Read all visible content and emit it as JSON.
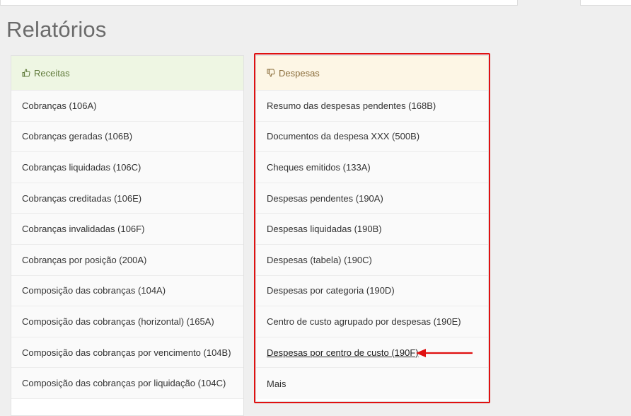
{
  "page": {
    "title": "Relatórios"
  },
  "receitas": {
    "heading": "Receitas",
    "icon": "thumbs-up-icon",
    "items": [
      "Cobranças (106A)",
      "Cobranças geradas (106B)",
      "Cobranças liquidadas (106C)",
      "Cobranças creditadas (106E)",
      "Cobranças invalidadas (106F)",
      "Cobranças por posição (200A)",
      "Composição das cobranças (104A)",
      "Composição das cobranças (horizontal) (165A)",
      "Composição das cobranças por vencimento (104B)",
      "Composição das cobranças por liquidação (104C)"
    ]
  },
  "despesas": {
    "heading": "Despesas",
    "icon": "thumbs-down-icon",
    "items": [
      "Resumo das despesas pendentes (168B)",
      "Documentos da despesa XXX (500B)",
      "Cheques emitidos (133A)",
      "Despesas pendentes (190A)",
      "Despesas liquidadas (190B)",
      "Despesas (tabela) (190C)",
      "Despesas por categoria (190D)",
      "Centro de custo agrupado por despesas (190E)",
      "Despesas por centro de custo (190F)",
      "Mais"
    ]
  },
  "annotation": {
    "frame_color": "#e01010",
    "arrow_color": "#e01010"
  }
}
